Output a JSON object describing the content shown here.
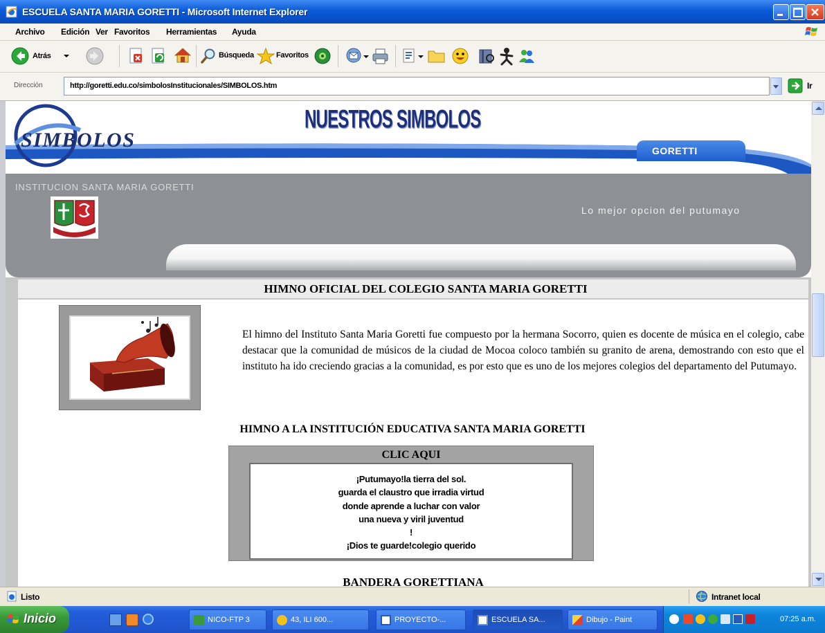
{
  "window": {
    "title": "ESCUELA SANTA MARIA GORETTI - Microsoft Internet Explorer"
  },
  "menu": {
    "items": [
      "Archivo",
      "Edición",
      "Ver",
      "Favoritos",
      "Herramientas",
      "Ayuda"
    ]
  },
  "toolbar": {
    "back_label": "Atrás",
    "search_label": "Búsqueda",
    "favorites_label": "Favoritos"
  },
  "address": {
    "label": "Dirección",
    "url": "http://goretti.edu.co/simbolosInstitucionales/SIMBOLOS.htm",
    "go_label": "Ir"
  },
  "page": {
    "header": {
      "logo_text": "SIMBOLOS",
      "title": "NUESTROS SIMBOLOS",
      "tab": "GORETTI",
      "institution": "INSTITUCION SANTA MARIA GORETTI",
      "slogan": "Lo mejor opcion del putumayo"
    },
    "hymn_info": {
      "heading": "HIMNO OFICIAL DEL COLEGIO SANTA MARIA GORETTI",
      "paragraph": "El himno del Instituto Santa Maria Goretti fue compuesto por la hermana Socorro, quien es docente de música en el colegio, cabe destacar que la comunidad de músicos de la ciudad de Mocoa coloco también su granito de arena, demostrando con esto que el instituto ha ido creciendo gracias a la comunidad, es por esto que es uno de los mejores colegios del departamento del Putumayo."
    },
    "hymn": {
      "heading": "HIMNO A LA INSTITUCIÓN EDUCATIVA SANTA MARIA GORETTI",
      "box_title": "CLIC AQUI",
      "lyrics": [
        "¡Putumayo!la tierra del sol.",
        "guarda el claustro que irradia virtud",
        "donde aprende a luchar con valor",
        "una nueva y viril juventud",
        "!",
        "¡Dios te guarde!colegio querido"
      ]
    },
    "flag": {
      "heading": "BANDERA GORETTIANA"
    }
  },
  "status": {
    "text": "Listo",
    "zone": "Intranet local"
  },
  "taskbar": {
    "start_label": "Inicio",
    "tasks": [
      {
        "label": "NICO-FTP 3"
      },
      {
        "label": "43, ILI 600..."
      },
      {
        "label": "PROYECTO-..."
      },
      {
        "label": "ESCUELA SA..."
      },
      {
        "label": "Dibujo - Paint"
      }
    ],
    "clock": "07:25 a.m."
  },
  "colors": {
    "title-blue": "#0a5ad6",
    "header-blue": "#1d57c2",
    "band-gray": "#8d9094",
    "task-blue": "#245edb",
    "start-green": "#3a9a3a"
  }
}
